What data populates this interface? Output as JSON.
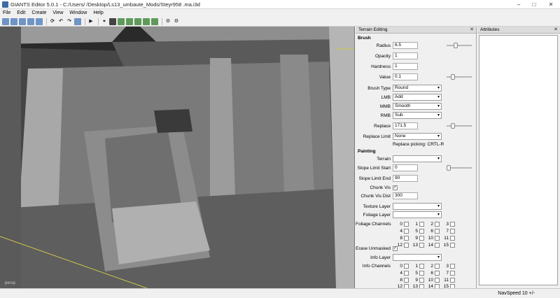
{
  "window": {
    "title": "GIANTS Editor 5.0.1 - C:/Users/                    /Desktop/Ls13_umbaute_Mods/Steyr958 .ma.i3d",
    "minimize_glyph": "–",
    "maximize_glyph": "□",
    "close_glyph": "✕"
  },
  "menu": [
    "File",
    "Edit",
    "Create",
    "View",
    "Window",
    "Help"
  ],
  "toolbar_icons": [
    "new-icon",
    "open-icon",
    "save-icon",
    "save-as-icon",
    "import-icon",
    "refresh-icon",
    "undo-icon",
    "redo-icon",
    "camera-icon",
    "play-icon",
    "select-icon",
    "move-icon",
    "rotate-icon",
    "scale-icon",
    "terrain-raise-icon",
    "terrain-paint-icon",
    "foliage-icon",
    "settings-icon",
    "snap-icon"
  ],
  "viewport": {
    "camera_label": "persp"
  },
  "terrain_panel": {
    "title": "Terrain Editing",
    "close_glyph": "✕",
    "brush_section": "Brush",
    "radius_label": "Radius",
    "radius_value": "6.5",
    "opacity_label": "Opacity",
    "opacity_value": "1",
    "hardness_label": "Hardness",
    "hardness_value": "1",
    "value_label": "Value",
    "value_value": "0.1",
    "brush_type_label": "Brush Type",
    "brush_type_value": "Round",
    "lmb_label": "LMB",
    "lmb_value": "Add",
    "mmb_label": "MMB",
    "mmb_value": "Smooth",
    "rmb_label": "RMB",
    "rmb_value": "Sub",
    "replace_label": "Replace",
    "replace_value": "171.5",
    "replace_limit_label": "Replace Limit",
    "replace_limit_value": "None",
    "replace_picking_note": "Replace picking: CRTL-R",
    "painting_section": "Painting",
    "terrain_label": "Terrain",
    "terrain_value": "",
    "slope_start_label": "Slope Limit Start",
    "slope_start_value": "0",
    "slope_end_label": "Slope Limit End",
    "slope_end_value": "90",
    "chunk_vis_label": "Chunk Vis",
    "chunk_vis_dist_label": "Chunk Vis Dist",
    "chunk_vis_dist_value": "300",
    "texture_layer_label": "Texture Layer",
    "texture_layer_value": "",
    "foliage_layer_label": "Foliage Layer",
    "foliage_layer_value": "",
    "foliage_channels_label": "Foliage Channels",
    "foliage_channels": [
      "0",
      "1",
      "2",
      "3",
      "4",
      "5",
      "6",
      "7",
      "8",
      "9",
      "10",
      "11",
      "12",
      "13",
      "14",
      "15"
    ],
    "erase_unmasked_label": "Erase Unmasked",
    "info_layer_label": "Info Layer",
    "info_layer_value": "",
    "info_channels_label": "Info Channels",
    "info_channels": [
      "0",
      "1",
      "2",
      "3",
      "4",
      "5",
      "6",
      "7",
      "8",
      "9",
      "10",
      "11",
      "12",
      "13",
      "14",
      "15"
    ],
    "check_glyph": "✓"
  },
  "attributes_panel": {
    "title": "Attributes",
    "close_glyph": "✕"
  },
  "status": {
    "nav_speed": "NavSpeed 10 +/-"
  },
  "colors": {
    "viewport_bg": "#3f3f3f",
    "panel_bg": "#f0f0f0",
    "accent_blue": "#6f94c6"
  }
}
